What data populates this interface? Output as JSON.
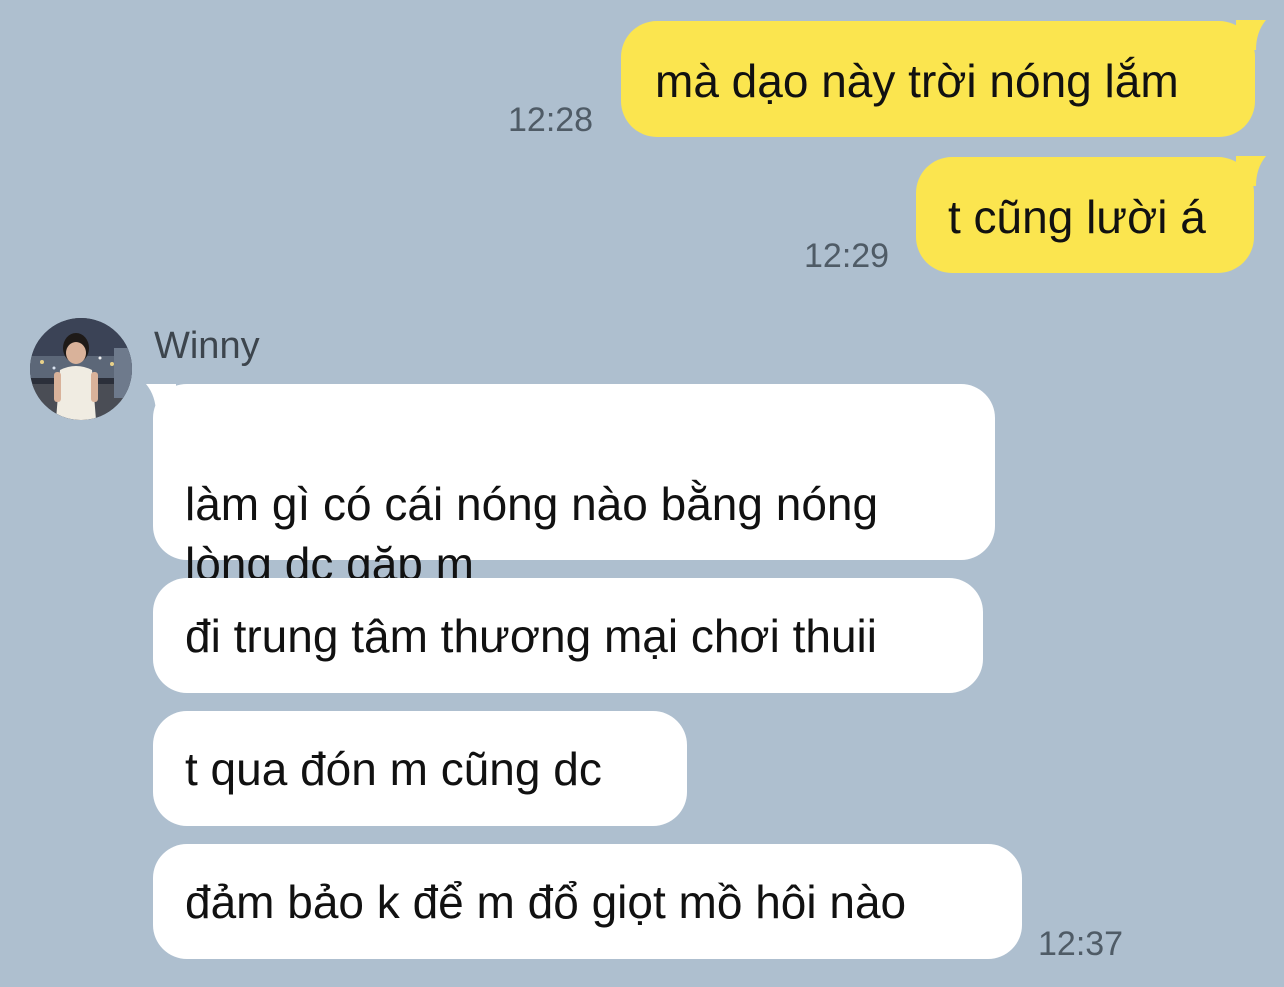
{
  "chat": {
    "contact": {
      "name": "Winny",
      "avatar_icon": "profile-photo-icon"
    },
    "outgoing": [
      {
        "text": "mà dạo này trời nóng lắm",
        "time": "12:28"
      },
      {
        "text": "t cũng lười á",
        "time": "12:29"
      }
    ],
    "incoming": [
      {
        "text": "làm gì có cái nóng nào bằng nóng\nlòng dc gặp m"
      },
      {
        "text": "đi trung tâm thương mại chơi thuii"
      },
      {
        "text": "t qua đón m cũng dc"
      },
      {
        "text": "đảm bảo k để m đổ giọt mồ hôi nào",
        "time": "12:37"
      }
    ]
  },
  "colors": {
    "background": "#aebfcf",
    "outgoing_bubble": "#fbe54f",
    "incoming_bubble": "#ffffff",
    "timestamp": "#4f5b66"
  }
}
